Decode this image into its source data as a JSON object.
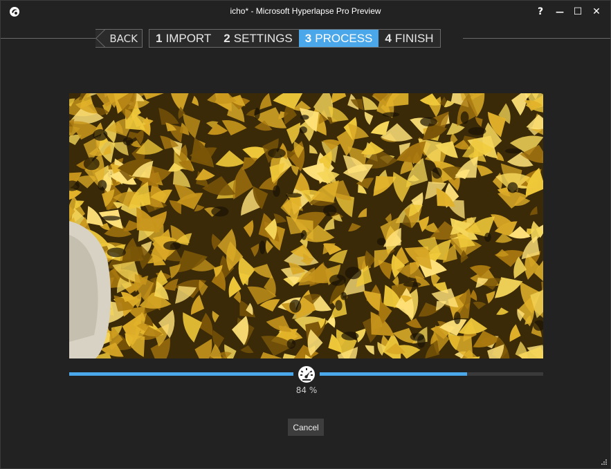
{
  "window": {
    "title": "icho* - Microsoft Hyperlapse Pro Preview",
    "controls": {
      "help": "?",
      "minimize": "—",
      "maximize": "☐",
      "close": "✕"
    }
  },
  "wizard": {
    "back_label": "BACK",
    "steps": [
      {
        "number": "1",
        "label": "IMPORT",
        "active": false
      },
      {
        "number": "2",
        "label": "SETTINGS",
        "active": false
      },
      {
        "number": "3",
        "label": "PROCESS",
        "active": true
      },
      {
        "number": "4",
        "label": "FINISH",
        "active": false
      }
    ]
  },
  "preview": {
    "icons": [
      "speed-gauge-icon",
      "app-logo-icon",
      "resize-grip-icon",
      "back-arrow-icon"
    ]
  },
  "progress": {
    "percent": 84,
    "percent_label": "84 %"
  },
  "actions": {
    "cancel_label": "Cancel"
  },
  "colors": {
    "accent": "#4aa7ea",
    "background": "#222222",
    "track": "#3a3a3a"
  }
}
